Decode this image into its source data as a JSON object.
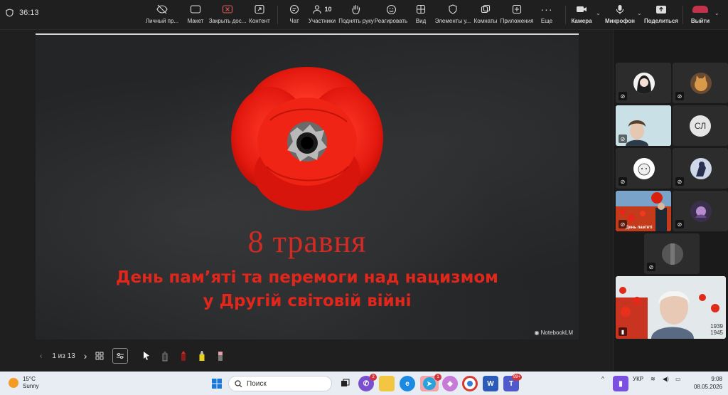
{
  "topbar": {
    "timer": "36:13",
    "buttons": {
      "private": "Личный пр...",
      "layout": "Макет",
      "close_access": "Закрыть дос...",
      "content": "Контент",
      "chat": "Чат",
      "participants": "Участники",
      "participants_count": "10",
      "raise_hand": "Поднять руку",
      "react": "Реагировать",
      "view": "Вид",
      "elements": "Элементы у...",
      "rooms": "Комнаты",
      "apps": "Приложения",
      "more": "Еще",
      "camera": "Камера",
      "mic": "Микрофон",
      "share": "Поделиться",
      "leave": "Выйти"
    }
  },
  "slide": {
    "date": "8 травня",
    "line1": "День пам’яті та перемоги над нацизмом",
    "line2": "у Другій світовій війні",
    "watermark": "NotebookLM"
  },
  "presentation": {
    "page": "1 из 13"
  },
  "gallery": {
    "initials": "СЛ",
    "tile_text_poster": "День пам'яті",
    "tile_years": "1939 1945"
  },
  "taskbar": {
    "temperature": "15°C",
    "weather": "Sunny",
    "search_placeholder": "Поиск",
    "language": "УКР",
    "time": "9:08",
    "date": "08.05.2026",
    "badge_viber": "2",
    "badge_telegram": "1",
    "badge_teams": "99+"
  },
  "colors": {
    "accent_red": "#e1261c",
    "leave_red": "#c4314b",
    "copilot_purple": "#7b4fe0"
  }
}
